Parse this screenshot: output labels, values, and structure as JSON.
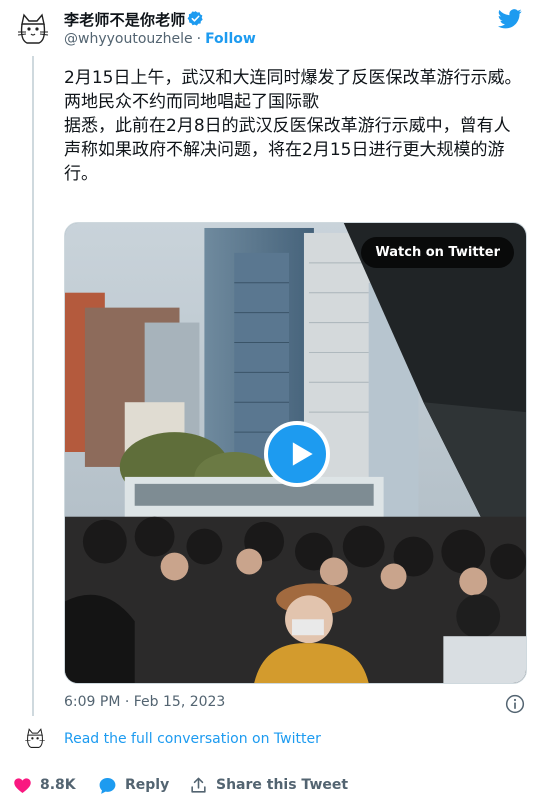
{
  "author": {
    "display_name": "李老师不是你老师",
    "handle": "@whyyoutouzhele",
    "separator": "·",
    "follow_label": "Follow"
  },
  "tweet": {
    "text": "2月15日上午，武汉和大连同时爆发了反医保改革游行示威。\n两地民众不约而同地唱起了国际歌\n据悉，此前在2月8日的武汉反医保改革游行示威中，曾有人声称如果政府不解决问题，将在2月15日进行更大规模的游行。",
    "timestamp": "6:09 PM · Feb 15, 2023"
  },
  "media": {
    "watch_label": "Watch on Twitter"
  },
  "footer": {
    "read_label": "Read the full conversation on Twitter",
    "like_count": "8.8K",
    "reply_label": "Reply",
    "share_label": "Share this Tweet"
  },
  "colors": {
    "accent": "#1d9bf0",
    "like": "#f91880",
    "secondary_text": "#536471"
  }
}
